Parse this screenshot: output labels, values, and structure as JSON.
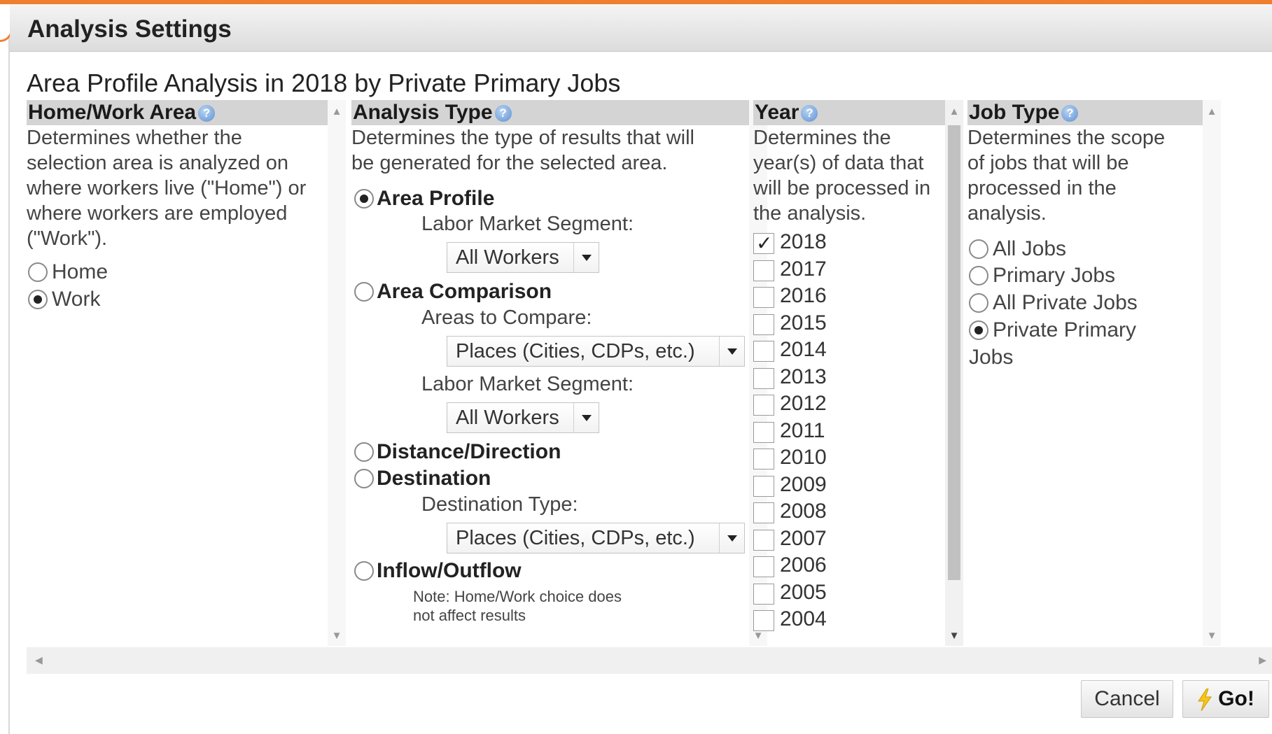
{
  "dialog": {
    "title": "Analysis Settings"
  },
  "subtitle": "Area Profile Analysis in 2018 by Private Primary Jobs",
  "home_work": {
    "header": "Home/Work Area",
    "description_lines": [
      "Determines whether the",
      "selection area is analyzed on",
      "where workers live (\"Home\") or",
      "where workers are employed",
      "(\"Work\")."
    ],
    "options": [
      {
        "label": "Home",
        "selected": false
      },
      {
        "label": "Work",
        "selected": true
      }
    ]
  },
  "analysis_type": {
    "header": "Analysis Type",
    "description_lines": [
      "Determines the type of results that will",
      "be generated for the selected area."
    ],
    "area_profile": {
      "label": "Area Profile",
      "selected": true,
      "segment_label": "Labor Market Segment:",
      "segment_value": "All Workers"
    },
    "area_comparison": {
      "label": "Area Comparison",
      "selected": false,
      "compare_label": "Areas to Compare:",
      "compare_value": "Places (Cities, CDPs, etc.)",
      "segment_label": "Labor Market Segment:",
      "segment_value": "All Workers"
    },
    "distance_direction": {
      "label": "Distance/Direction",
      "selected": false
    },
    "destination": {
      "label": "Destination",
      "selected": false,
      "type_label": "Destination Type:",
      "type_value": "Places (Cities, CDPs, etc.)"
    },
    "inflow_outflow": {
      "label": "Inflow/Outflow",
      "selected": false,
      "note_lines": [
        "Note: Home/Work choice does",
        "not affect results"
      ]
    }
  },
  "year": {
    "header": "Year",
    "description_lines": [
      "Determines the",
      "year(s) of data that",
      "will be processed in",
      "the analysis."
    ],
    "years": [
      {
        "label": "2018",
        "checked": true
      },
      {
        "label": "2017",
        "checked": false
      },
      {
        "label": "2016",
        "checked": false
      },
      {
        "label": "2015",
        "checked": false
      },
      {
        "label": "2014",
        "checked": false
      },
      {
        "label": "2013",
        "checked": false
      },
      {
        "label": "2012",
        "checked": false
      },
      {
        "label": "2011",
        "checked": false
      },
      {
        "label": "2010",
        "checked": false
      },
      {
        "label": "2009",
        "checked": false
      },
      {
        "label": "2008",
        "checked": false
      },
      {
        "label": "2007",
        "checked": false
      },
      {
        "label": "2006",
        "checked": false
      },
      {
        "label": "2005",
        "checked": false
      },
      {
        "label": "2004",
        "checked": false
      }
    ]
  },
  "job_type": {
    "header": "Job Type",
    "description_lines": [
      "Determines the scope",
      "of jobs that will be",
      "processed in the",
      "analysis."
    ],
    "options": [
      {
        "label": "All Jobs",
        "selected": false
      },
      {
        "label": "Primary Jobs",
        "selected": false
      },
      {
        "label": "All Private Jobs",
        "selected": false
      },
      {
        "label": "Private Primary",
        "label_cont": "Jobs",
        "selected": true
      }
    ]
  },
  "footer": {
    "cancel_label": "Cancel",
    "go_label": "Go!"
  },
  "icons": {
    "help": "help-icon",
    "go": "lightning-bolt-icon",
    "dropdown": "chevron-down-icon"
  },
  "colors": {
    "accent_orange": "#ef7f2e",
    "header_gray": "#d4d4d4",
    "help_blue": "#5d8fd0",
    "bolt_yellow": "#f5c518"
  }
}
